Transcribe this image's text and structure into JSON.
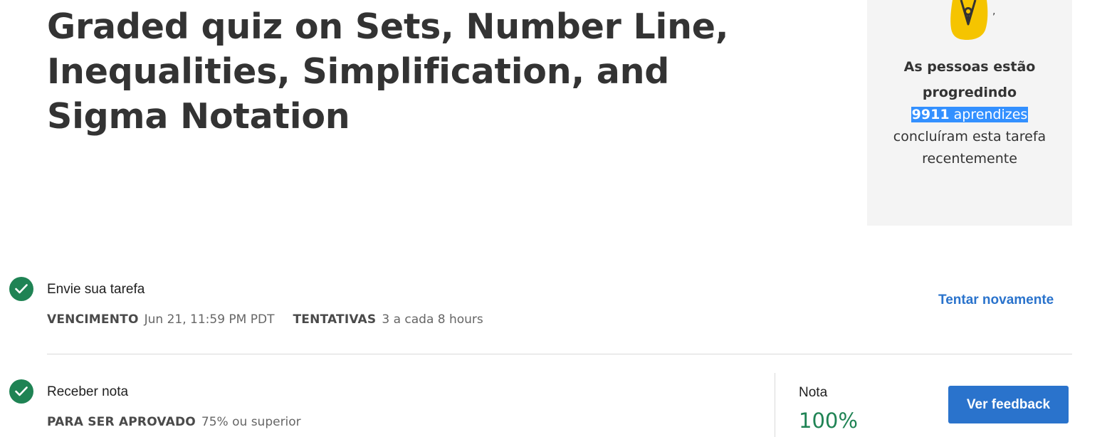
{
  "title": "Graded quiz on Sets, Number Line, Inequalities, Simplification, and Sigma Notation",
  "progress_card": {
    "icon": "pen-nib-icon",
    "heading": "As pessoas estão progredindo",
    "learners_count": "9911",
    "learners_label": "aprendizes",
    "body": "concluíram esta tarefa recentemente"
  },
  "submit_section": {
    "title": "Envie sua tarefa",
    "due_label": "VENCIMENTO",
    "due_value": "Jun 21, 11:59 PM PDT",
    "attempts_label": "TENTATIVAS",
    "attempts_value": "3 a cada 8 hours",
    "retry_label": "Tentar novamente",
    "status_icon": "check-circle-icon"
  },
  "grade_section": {
    "title": "Receber nota",
    "pass_label": "PARA SER APROVADO",
    "pass_value": "75% ou superior",
    "grade_label": "Nota",
    "grade_value": "100%",
    "feedback_label": "Ver feedback",
    "status_icon": "check-circle-icon"
  },
  "colors": {
    "success": "#1f8354",
    "primary": "#2a73cc",
    "highlight": "#3390ff",
    "card_bg": "#f4f4f4",
    "icon_yellow": "#f5c400"
  }
}
